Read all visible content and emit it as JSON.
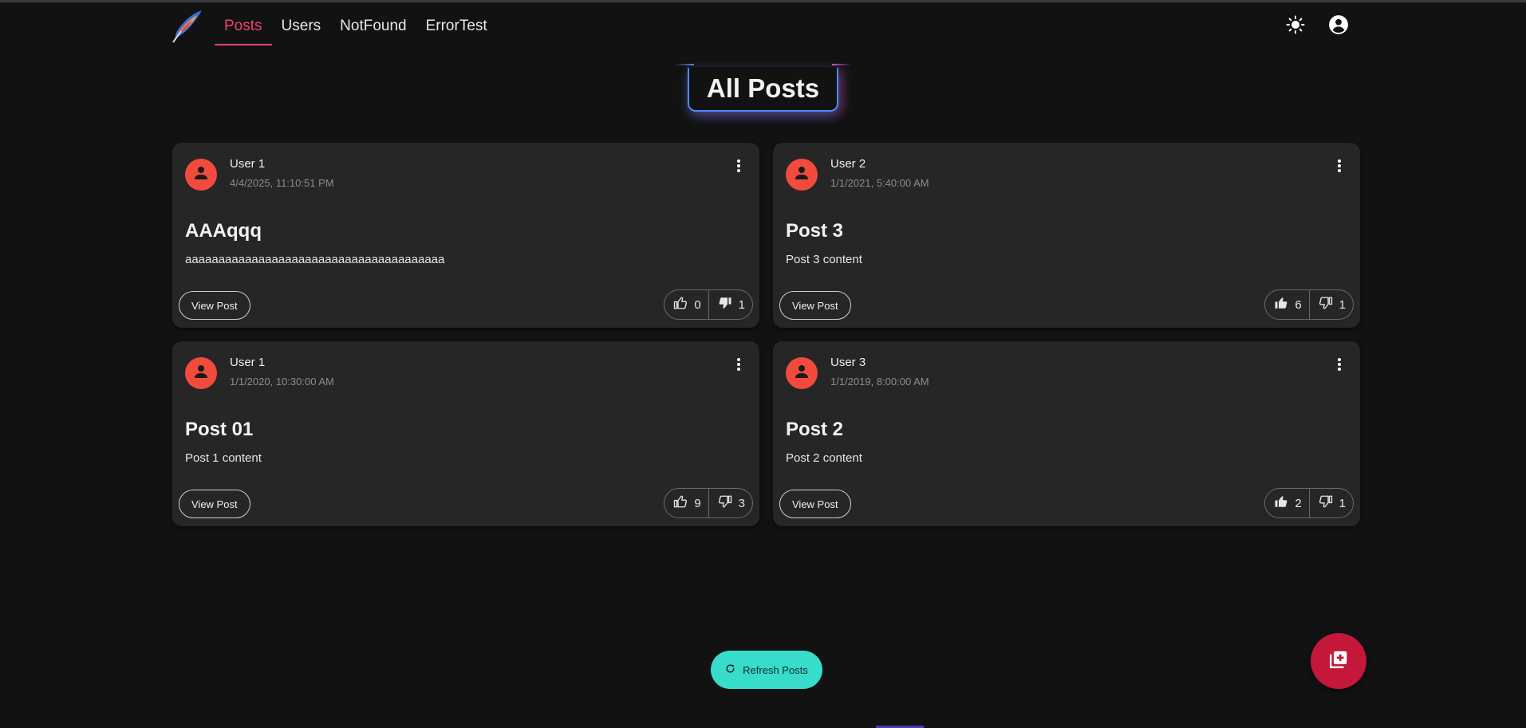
{
  "nav": {
    "items": [
      {
        "label": "Posts",
        "active": true
      },
      {
        "label": "Users",
        "active": false
      },
      {
        "label": "NotFound",
        "active": false
      },
      {
        "label": "ErrorTest",
        "active": false
      }
    ],
    "icons": {
      "logo": "feather-logo",
      "theme": "sun-icon",
      "account": "account-circle-icon"
    }
  },
  "page": {
    "title": "All Posts"
  },
  "posts": [
    {
      "author": "User 1",
      "date": "4/4/2025, 11:10:51 PM",
      "title": "AAAqqq",
      "content": "aaaaaaaaaaaaaaaaaaaaaaaaaaaaaaaaaaaaaaa",
      "view_label": "View Post",
      "likes": "0",
      "dislikes": "1",
      "liked": false,
      "disliked": true
    },
    {
      "author": "User 2",
      "date": "1/1/2021, 5:40:00 AM",
      "title": "Post 3",
      "content": "Post 3 content",
      "view_label": "View Post",
      "likes": "6",
      "dislikes": "1",
      "liked": true,
      "disliked": false
    },
    {
      "author": "User 1",
      "date": "1/1/2020, 10:30:00 AM",
      "title": "Post 01",
      "content": "Post 1 content",
      "view_label": "View Post",
      "likes": "9",
      "dislikes": "3",
      "liked": false,
      "disliked": false
    },
    {
      "author": "User 3",
      "date": "1/1/2019, 8:00:00 AM",
      "title": "Post 2",
      "content": "Post 2 content",
      "view_label": "View Post",
      "likes": "2",
      "dislikes": "1",
      "liked": true,
      "disliked": false
    }
  ],
  "actions": {
    "refresh_label": "Refresh Posts",
    "add_icon": "add-post-icon"
  },
  "colors": {
    "accent": "#f0436b",
    "avatar": "#f24a3d",
    "refresh": "#38dccb",
    "fab": "#c4173a",
    "background": "#121212",
    "card": "#262626"
  }
}
